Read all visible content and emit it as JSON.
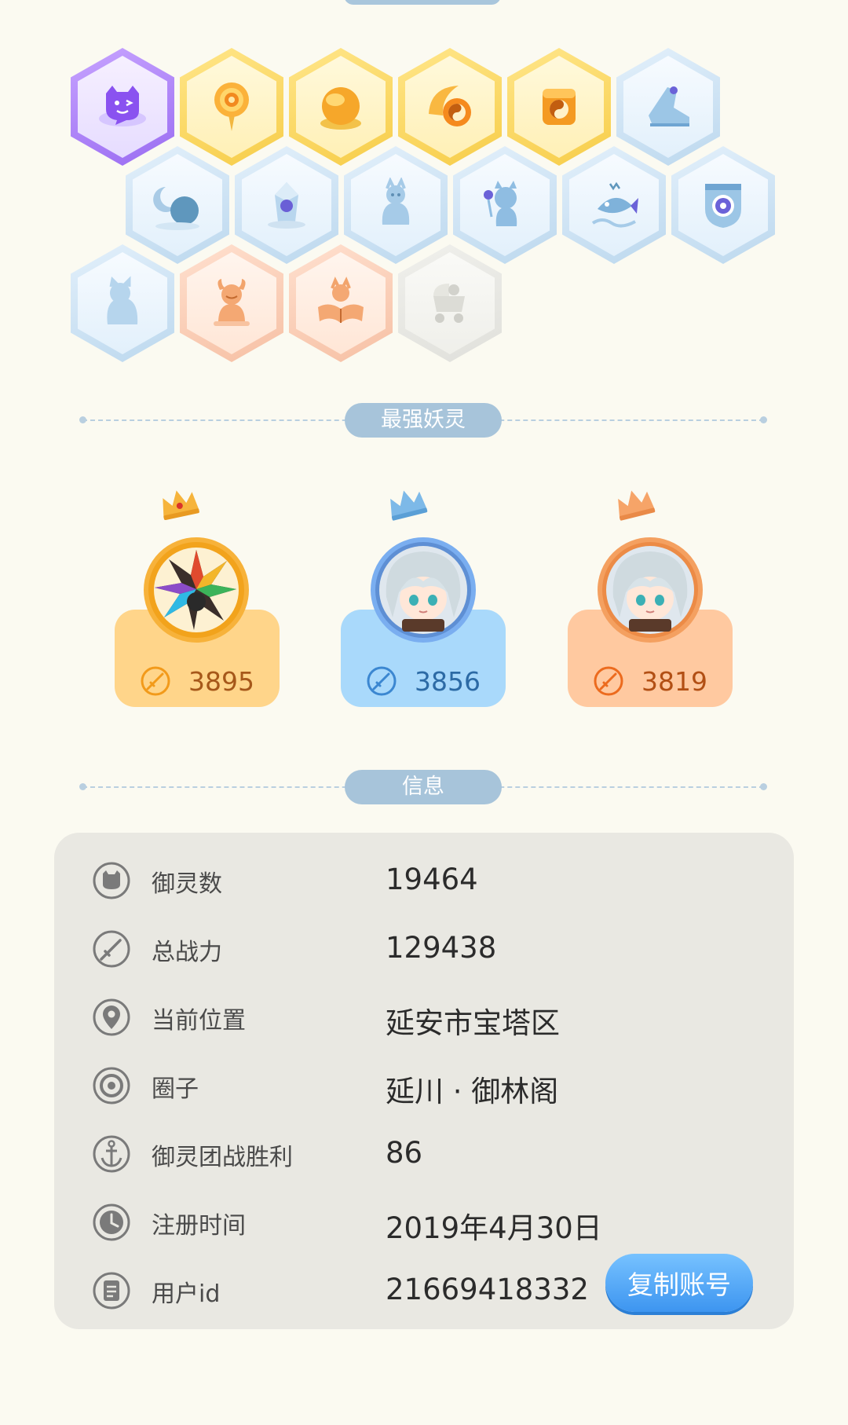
{
  "colors": {
    "background": "#fbfaf1",
    "gold_card": "#ffd58a",
    "blue_card": "#a9d9fb",
    "orange_card": "#ffc9a0",
    "button": "#4aa3f5"
  },
  "badges": [
    {
      "icon": "purple-spirit-icon",
      "tier": "purple"
    },
    {
      "icon": "sun-disc-icon",
      "tier": "gold"
    },
    {
      "icon": "golden-orb-icon",
      "tier": "gold"
    },
    {
      "icon": "yinyang-comet-icon",
      "tier": "gold"
    },
    {
      "icon": "yinyang-box-icon",
      "tier": "gold"
    },
    {
      "icon": "boot-icon",
      "tier": "blue"
    },
    {
      "icon": "moon-icon",
      "tier": "blue"
    },
    {
      "icon": "crystal-icon",
      "tier": "blue"
    },
    {
      "icon": "creature-statue-icon",
      "tier": "blue"
    },
    {
      "icon": "dog-icon",
      "tier": "blue"
    },
    {
      "icon": "fish-icon",
      "tier": "blue"
    },
    {
      "icon": "target-shield-icon",
      "tier": "blue"
    },
    {
      "icon": "kitten-icon",
      "tier": "blue"
    },
    {
      "icon": "horned-figure-icon",
      "tier": "peach"
    },
    {
      "icon": "book-fox-icon",
      "tier": "peach"
    },
    {
      "icon": "stroller-icon",
      "tier": "grey"
    }
  ],
  "strongest": {
    "title": "最强妖灵",
    "spirits": [
      {
        "power": "3895",
        "color": "gold",
        "crown": "gold-crown-icon"
      },
      {
        "power": "3856",
        "color": "blue",
        "crown": "blue-crown-icon"
      },
      {
        "power": "3819",
        "color": "orange",
        "crown": "orange-crown-icon"
      }
    ]
  },
  "info": {
    "title": "信息",
    "rows": [
      {
        "icon": "spirit-count-icon",
        "label": "御灵数",
        "value": "19464"
      },
      {
        "icon": "sword-icon",
        "label": "总战力",
        "value": "129438"
      },
      {
        "icon": "location-pin-icon",
        "label": "当前位置",
        "value": "延安市宝塔区"
      },
      {
        "icon": "circle-group-icon",
        "label": "圈子",
        "value": "延川 · 御林阁"
      },
      {
        "icon": "anchor-icon",
        "label": "御灵团战胜利",
        "value": "86"
      },
      {
        "icon": "clock-icon",
        "label": "注册时间",
        "value": "2019年4月30日"
      },
      {
        "icon": "id-card-icon",
        "label": "用户id",
        "value": "21669418332"
      }
    ],
    "copy_button": "复制账号"
  }
}
